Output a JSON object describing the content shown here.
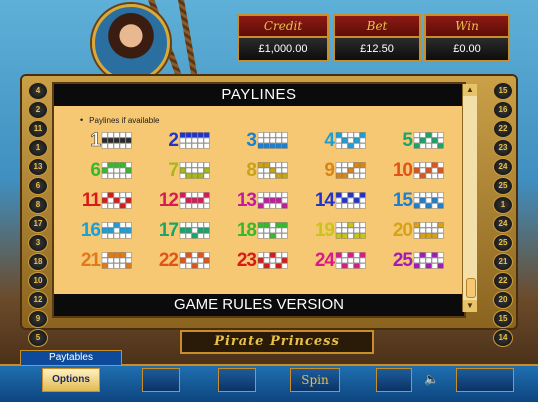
{
  "meters": [
    {
      "label": "Credit",
      "value": "£1,000.00"
    },
    {
      "label": "Bet",
      "value": "£12.50"
    },
    {
      "label": "Win",
      "value": "£0.00"
    }
  ],
  "panel": {
    "title": "PAYLINES",
    "bullet": "Paylines if available",
    "footer": "GAME RULES VERSION"
  },
  "left_numbers": [
    "4",
    "2",
    "11",
    "1",
    "13",
    "6",
    "8",
    "17",
    "3",
    "18",
    "10",
    "12",
    "9",
    "5"
  ],
  "right_numbers": [
    "15",
    "16",
    "22",
    "23",
    "24",
    "25",
    "1",
    "24",
    "25",
    "21",
    "22",
    "20",
    "15",
    "14"
  ],
  "paylines": [
    {
      "num": "1",
      "color": "#ffffff",
      "row_top": [
        0,
        0,
        0,
        0,
        0
      ],
      "pattern": [
        1,
        1,
        1,
        1,
        1
      ]
    },
    {
      "num": "2",
      "color": "#2233cc",
      "pattern": [
        0,
        0,
        0,
        0,
        0
      ]
    },
    {
      "num": "3",
      "color": "#1c7fcf",
      "pattern": [
        2,
        2,
        2,
        2,
        2
      ]
    },
    {
      "num": "4",
      "color": "#1aa0d8",
      "pattern": [
        0,
        1,
        2,
        1,
        0
      ]
    },
    {
      "num": "5",
      "color": "#16a66a",
      "pattern": [
        2,
        1,
        0,
        1,
        2
      ]
    },
    {
      "num": "6",
      "color": "#38b82e",
      "pattern": [
        1,
        0,
        0,
        0,
        1
      ]
    },
    {
      "num": "7",
      "color": "#a6b81a",
      "pattern": [
        1,
        2,
        2,
        2,
        1
      ]
    },
    {
      "num": "8",
      "color": "#c8a218",
      "pattern": [
        0,
        0,
        1,
        2,
        2
      ]
    },
    {
      "num": "9",
      "color": "#d88418",
      "pattern": [
        2,
        2,
        1,
        0,
        0
      ]
    },
    {
      "num": "10",
      "color": "#e0541a",
      "pattern": [
        1,
        2,
        1,
        0,
        1
      ]
    },
    {
      "num": "11",
      "color": "#d81a1a",
      "pattern": [
        1,
        0,
        1,
        2,
        1
      ]
    },
    {
      "num": "12",
      "color": "#d81a56",
      "pattern": [
        0,
        1,
        1,
        1,
        0
      ]
    },
    {
      "num": "13",
      "color": "#c21aa0",
      "pattern": [
        2,
        1,
        1,
        1,
        2
      ]
    },
    {
      "num": "14",
      "color": "#2233cc",
      "pattern": [
        0,
        1,
        0,
        1,
        0
      ]
    },
    {
      "num": "15",
      "color": "#1c7fcf",
      "pattern": [
        2,
        1,
        2,
        1,
        2
      ]
    },
    {
      "num": "16",
      "color": "#1aa0d8",
      "pattern": [
        1,
        1,
        0,
        1,
        1
      ]
    },
    {
      "num": "17",
      "color": "#16a66a",
      "pattern": [
        1,
        1,
        2,
        1,
        1
      ]
    },
    {
      "num": "18",
      "color": "#38b82e",
      "pattern": [
        0,
        0,
        2,
        0,
        0
      ]
    },
    {
      "num": "19",
      "color": "#c8c418",
      "pattern": [
        2,
        2,
        0,
        2,
        2
      ]
    },
    {
      "num": "20",
      "color": "#d8a218",
      "pattern": [
        0,
        2,
        2,
        2,
        0
      ]
    },
    {
      "num": "21",
      "color": "#e07a18",
      "pattern": [
        2,
        0,
        0,
        0,
        2
      ]
    },
    {
      "num": "22",
      "color": "#e0541a",
      "pattern": [
        1,
        0,
        2,
        0,
        1
      ]
    },
    {
      "num": "23",
      "color": "#d81a1a",
      "pattern": [
        1,
        2,
        0,
        2,
        1
      ]
    },
    {
      "num": "24",
      "color": "#d81a8a",
      "pattern": [
        0,
        2,
        0,
        2,
        0
      ]
    },
    {
      "num": "25",
      "color": "#a21ab8",
      "pattern": [
        2,
        0,
        2,
        0,
        2
      ]
    }
  ],
  "logo": "Pirate Princess",
  "tabs": {
    "paytables": "Paytables"
  },
  "buttons": {
    "options": "Options",
    "spin": "Spin"
  },
  "icons": {
    "portrait": "pirate-princess-portrait",
    "speaker": "speaker-icon"
  }
}
